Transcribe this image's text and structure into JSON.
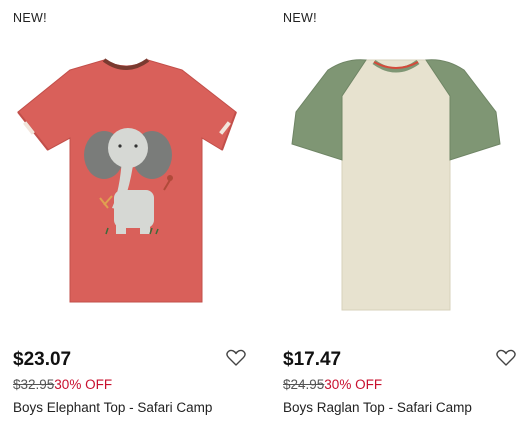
{
  "colors": {
    "sale_red": "#c8102e",
    "text": "#111111",
    "strike": "#555555"
  },
  "products": [
    {
      "badge": "NEW!",
      "price": "$23.07",
      "original_price": "$32.95",
      "discount": "30% OFF",
      "title": "Boys Elephant Top - Safari Camp",
      "icon": "heart-outline-icon"
    },
    {
      "badge": "NEW!",
      "price": "$17.47",
      "original_price": "$24.95",
      "discount": "30% OFF",
      "title": "Boys Raglan Top - Safari Camp",
      "icon": "heart-outline-icon"
    }
  ]
}
